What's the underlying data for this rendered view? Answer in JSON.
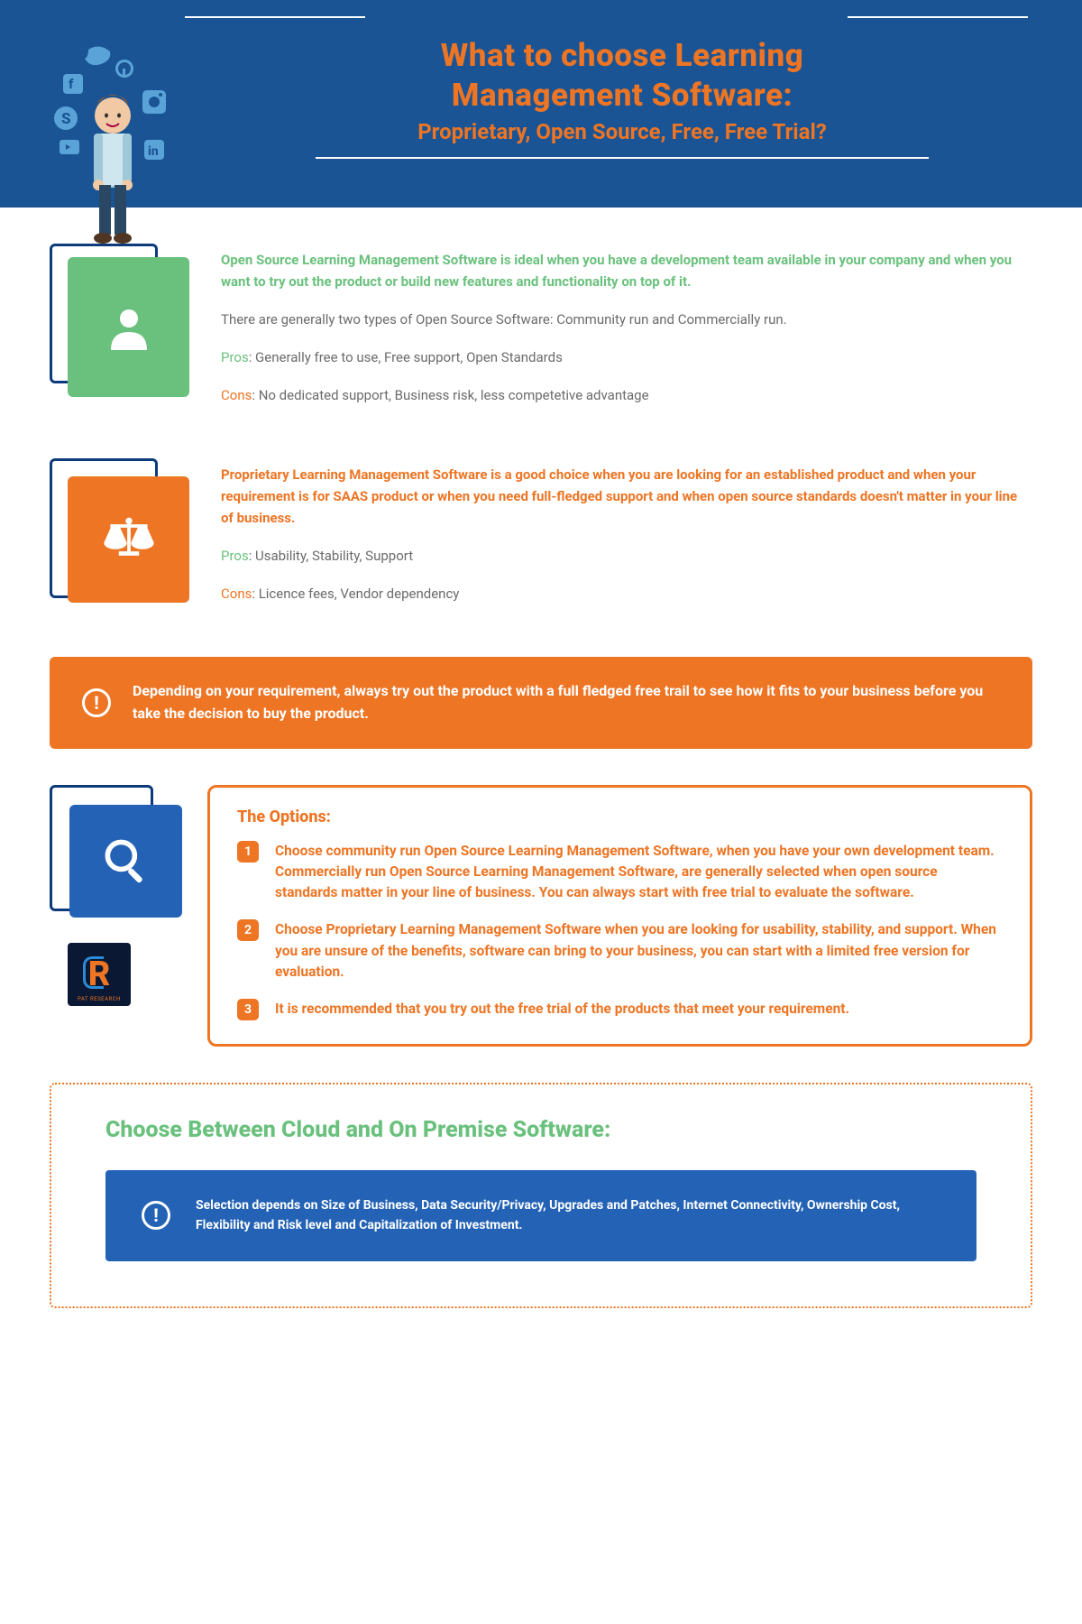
{
  "header": {
    "title_line1": "What to choose Learning",
    "title_line2": "Management Software:",
    "subtitle": "Proprietary, Open Source, Free, Free Trial?"
  },
  "open_source": {
    "intro": "Open Source Learning Management Software is ideal when you have a development team available in your company and when you want to try out the product or build new features and functionality on top of it.",
    "types": "There are generally two types of Open Source Software: Community run and Commercially run.",
    "pros_label": "Pros",
    "pros": ": Generally free to use, Free support, Open Standards",
    "cons_label": "Cons",
    "cons": ": No dedicated support, Business risk, less competetive advantage"
  },
  "proprietary": {
    "intro": "Proprietary Learning Management Software is a good choice when you are looking for an established product and when your requirement is for SAAS product or when you need full-fledged support and when open source standards doesn't matter in your line of business.",
    "pros_label": "Pros",
    "pros": ": Usability, Stability, Support",
    "cons_label": "Cons",
    "cons": ": Licence fees, Vendor dependency"
  },
  "banner1": "Depending on your requirement, always try out the product with a full fledged free trail to see how it fits to your business before you take the decision to buy the product.",
  "options": {
    "title": "The Options:",
    "items": [
      {
        "n": "1",
        "text": "Choose community run Open Source Learning Management Software, when you have your own development team. Commercially run Open Source Learning Management Software, are generally selected when open source standards matter in your line of business. You can always start with free trial to evaluate the software."
      },
      {
        "n": "2",
        "text": "Choose Proprietary Learning Management Software when you are looking for usability, stability, and support. When you are unsure of the benefits, software can bring to your business, you can start with a limited free version for evaluation."
      },
      {
        "n": "3",
        "text": "It is recommended that you try out the free trial of the products that meet your requirement."
      }
    ]
  },
  "cloud_section": {
    "title": "Choose Between Cloud and On Premise Software:",
    "text": "Selection depends on Size of Business, Data Security/Privacy, Upgrades and Patches, Internet Connectivity, Ownership Cost, Flexibility and Risk level and Capitalization of Investment."
  },
  "logo_text": "PAT RESEARCH"
}
